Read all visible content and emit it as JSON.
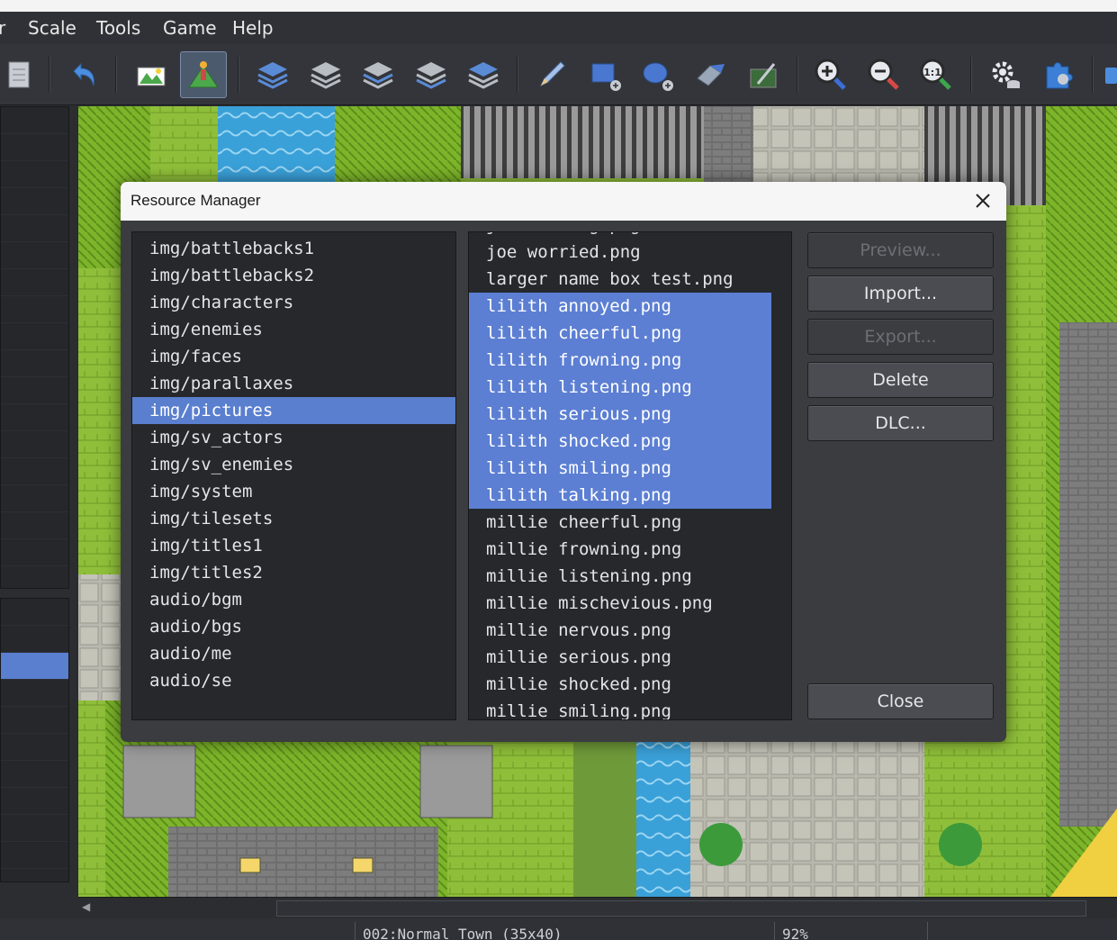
{
  "menu": [
    "r",
    "Scale",
    "Tools",
    "Game",
    "Help"
  ],
  "toolbar": {
    "icons": [
      "notebook-icon",
      "undo-icon",
      "map-mode-icon",
      "event-mode-icon",
      "layer-1-icon",
      "layer-2-icon",
      "layer-3-icon",
      "layer-4-icon",
      "layer-auto-icon",
      "pencil-icon",
      "rectangle-icon",
      "ellipse-icon",
      "fill-icon",
      "shadow-pen-icon",
      "zoom-in-icon",
      "zoom-out-icon",
      "zoom-actual-icon",
      "database-icon",
      "plugin-manager-icon"
    ],
    "actual_size_label": "1:1"
  },
  "dialog": {
    "title": "Resource Manager",
    "folders": [
      "img/battlebacks1",
      "img/battlebacks2",
      "img/characters",
      "img/enemies",
      "img/faces",
      "img/parallaxes",
      "img/pictures",
      "img/sv_actors",
      "img/sv_enemies",
      "img/system",
      "img/tilesets",
      "img/titles1",
      "img/titles2",
      "audio/bgm",
      "audio/bgs",
      "audio/me",
      "audio/se"
    ],
    "selected_folder": "img/pictures",
    "files": [
      "joe talking.png",
      "joe worried.png",
      "larger name box test.png",
      "lilith annoyed.png",
      "lilith cheerful.png",
      "lilith frowning.png",
      "lilith listening.png",
      "lilith serious.png",
      "lilith shocked.png",
      "lilith smiling.png",
      "lilith talking.png",
      "millie cheerful.png",
      "millie frowning.png",
      "millie listening.png",
      "millie mischevious.png",
      "millie nervous.png",
      "millie serious.png",
      "millie shocked.png",
      "millie smiling.png"
    ],
    "selected_files": [
      3,
      4,
      5,
      6,
      7,
      8,
      9,
      10
    ],
    "buttons": {
      "preview": "Preview...",
      "import": "Import...",
      "export": "Export...",
      "delete": "Delete",
      "dlc": "DLC...",
      "close": "Close"
    }
  },
  "status": {
    "map": "002:Normal Town (35x40)",
    "zoom": "92%"
  },
  "colors": {
    "selection": "#5a7fcf",
    "grass": "#8fbf3a",
    "water": "#3aa0d8",
    "stone": "#b8b8ae"
  }
}
